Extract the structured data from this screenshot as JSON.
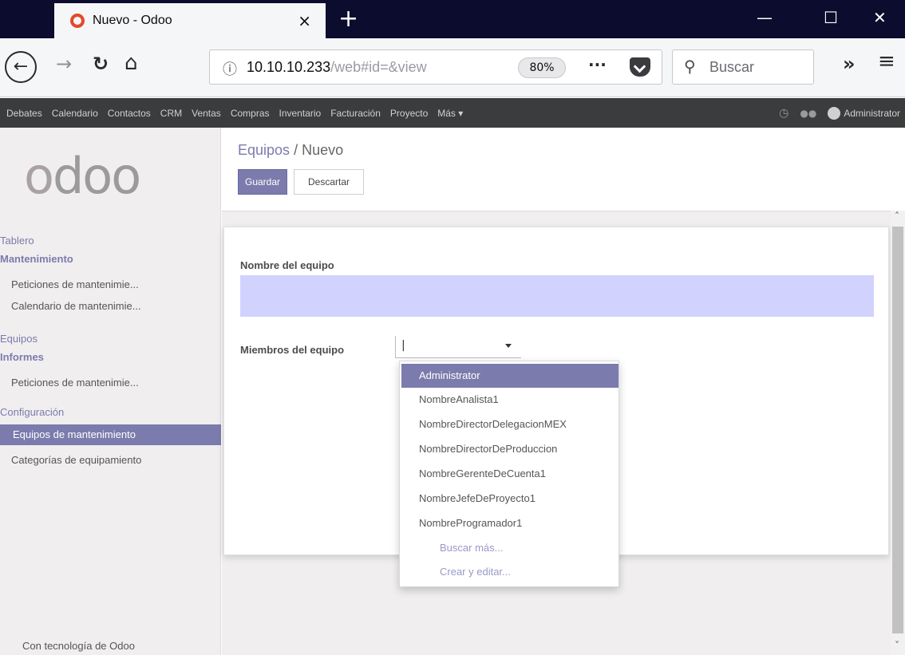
{
  "browser": {
    "tab_title": "Nuevo - Odoo",
    "tab_close": "×",
    "new_tab": "+",
    "win_minimize": "—",
    "win_maximize": "☐",
    "win_close": "✕",
    "url_host": "10.10.10.233",
    "url_path": "/web#id=&view",
    "zoom": "80%",
    "page_actions": "···",
    "search_placeholder": "Buscar",
    "overflow": "»",
    "menu": "≡",
    "icons": [
      "back-icon",
      "forward-icon",
      "reload-icon",
      "home-icon",
      "info-icon",
      "pocket-icon",
      "search-icon",
      "hamburger-icon"
    ]
  },
  "top_menu": {
    "items": [
      "Debates",
      "Calendario",
      "Contactos",
      "CRM",
      "Ventas",
      "Compras",
      "Inventario",
      "Facturación",
      "Proyecto",
      "Más ▾"
    ],
    "user": "Administrator"
  },
  "sidebar": {
    "tablero": "Tablero",
    "mantenimiento": "Mantenimiento",
    "peticiones": "Peticiones de mantenimie...",
    "calendario": "Calendario de mantenimie...",
    "equipos": "Equipos",
    "informes": "Informes",
    "informes_peticiones": "Peticiones de mantenimie...",
    "configuracion": "Configuración",
    "equipos_mantenimiento": "Equipos de mantenimiento",
    "categorias": "Categorías de equipamiento",
    "footer": "Con tecnología de Odoo"
  },
  "main": {
    "breadcrumb_parent": "Equipos",
    "breadcrumb_sep": "/",
    "breadcrumb_current": "Nuevo",
    "save_label": "Guardar",
    "discard_label": "Descartar",
    "team_name_label": "Nombre del equipo",
    "team_name_value": "",
    "members_label": "Miembros del equipo",
    "members_value": "|"
  },
  "dropdown": {
    "items": [
      "Administrator",
      "NombreAnalista1",
      "NombreDirectorDelegacionMEX",
      "NombreDirectorDeProduccion",
      "NombreGerenteDeCuenta1",
      "NombreJefeDeProyecto1",
      "NombreProgramador1"
    ],
    "selected": "Administrator",
    "search_more": "Buscar más...",
    "create_edit": "Crear y editar..."
  },
  "colors": {
    "accent": "#7c7bad",
    "top_menu_bg": "#3b3c3d",
    "input_required": "#d2d2ff"
  }
}
